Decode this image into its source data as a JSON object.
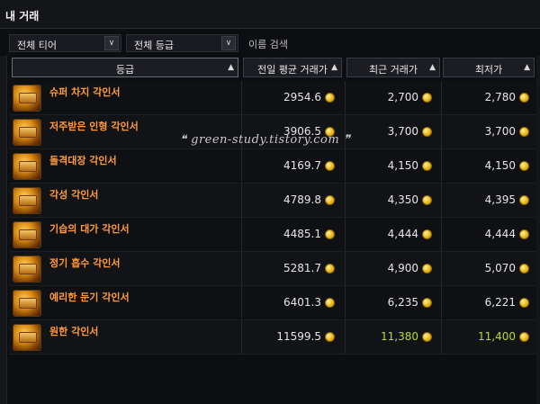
{
  "tabs": {
    "my_trade": "내 거래"
  },
  "filters": {
    "tier": "전체 티어",
    "grade": "전체 등급",
    "search_placeholder": "이름 검색",
    "chevron": "∨"
  },
  "table": {
    "headers": {
      "grade": "등급",
      "prev_avg": "전일 평균 거래가",
      "recent": "최근 거래가",
      "lowest": "최저가",
      "sort_arrow": "▲"
    },
    "rows": [
      {
        "name": "슈퍼 차지 각인서",
        "prev_avg": "2954.6",
        "recent": "2,700",
        "lowest": "2,780",
        "highlight": false
      },
      {
        "name": "저주받은 인형 각인서",
        "prev_avg": "3906.5",
        "recent": "3,700",
        "lowest": "3,700",
        "highlight": false
      },
      {
        "name": "돌격대장 각인서",
        "prev_avg": "4169.7",
        "recent": "4,150",
        "lowest": "4,150",
        "highlight": false
      },
      {
        "name": "각성 각인서",
        "prev_avg": "4789.8",
        "recent": "4,350",
        "lowest": "4,395",
        "highlight": false
      },
      {
        "name": "기습의 대가 각인서",
        "prev_avg": "4485.1",
        "recent": "4,444",
        "lowest": "4,444",
        "highlight": false
      },
      {
        "name": "정기 흡수 각인서",
        "prev_avg": "5281.7",
        "recent": "4,900",
        "lowest": "5,070",
        "highlight": false
      },
      {
        "name": "예리한 둔기 각인서",
        "prev_avg": "6401.3",
        "recent": "6,235",
        "lowest": "6,221",
        "highlight": false
      },
      {
        "name": "원한 각인서",
        "prev_avg": "11599.5",
        "recent": "11,380",
        "lowest": "11,400",
        "highlight": true
      }
    ]
  },
  "watermark": "❝ green-study.tistory.com ❞",
  "colors": {
    "item_name": "#ff9a3c",
    "highlight_price": "#b6d93a",
    "coin": "#f2c22a"
  },
  "icons": {
    "item": "engraving-book-icon",
    "currency": "gold-coin-icon"
  }
}
